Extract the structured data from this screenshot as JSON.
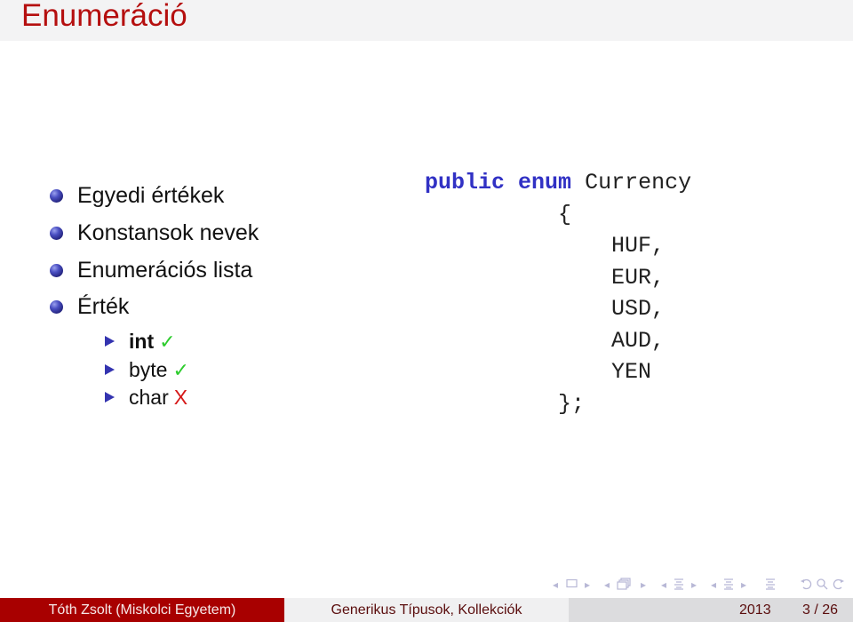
{
  "slide": {
    "title": "Enumeráció"
  },
  "bullets": [
    {
      "text": "Egyedi értékek"
    },
    {
      "text": "Konstansok nevek"
    },
    {
      "text": "Enumerációs lista"
    },
    {
      "text": "Érték"
    }
  ],
  "subbullets": [
    {
      "text": "int",
      "mark": "✓",
      "mark_type": "check",
      "bold": true
    },
    {
      "text": "byte",
      "mark": "✓",
      "mark_type": "check",
      "bold": false
    },
    {
      "text": "char",
      "mark": "X",
      "mark_type": "cross",
      "bold": false
    }
  ],
  "code": {
    "keyword1": "public",
    "keyword2": "enum",
    "type_name": "Currency",
    "open_brace": "{",
    "members": [
      "HUF,",
      "EUR,",
      "USD,",
      "AUD,",
      "YEN"
    ],
    "close_brace": "};"
  },
  "navigation": {
    "icons": [
      "arrow-left-icon",
      "slide-frame-icon",
      "arrow-right-icon",
      "arrow-left-icon",
      "subsection-icon",
      "arrow-right-icon",
      "arrow-left-icon",
      "section-icon",
      "arrow-right-icon",
      "arrow-left-icon",
      "document-icon",
      "arrow-right-icon",
      "appendix-icon",
      "back-icon",
      "search-icon",
      "forward-icon"
    ]
  },
  "footer": {
    "author": "Tóth Zsolt  (Miskolci Egyetem)",
    "title": "Generikus Típusok, Kollekciók",
    "year": "2013",
    "page": "3 / 26"
  },
  "colors": {
    "title_red": "#b50f0f",
    "footer_red": "#a80000",
    "keyword_blue": "#3131c4",
    "check_green": "#2dcc2d",
    "cross_red": "#d61a1a",
    "bullet_blue": "#24247e"
  }
}
